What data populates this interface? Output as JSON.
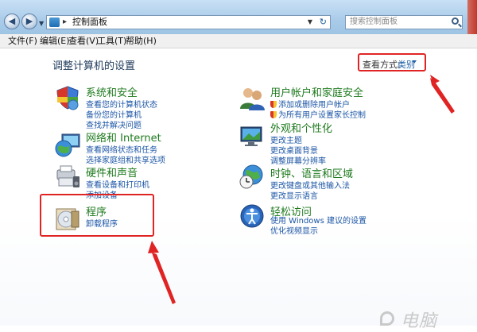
{
  "address_bar": {
    "path": "控制面板",
    "search_placeholder": "搜索控制面板"
  },
  "menu": [
    "文件(F)",
    "编辑(E)",
    "查看(V)",
    "工具(T)",
    "帮助(H)"
  ],
  "page_title": "调整计算机的设置",
  "view_by": {
    "label": "查看方式:",
    "value": "类别"
  },
  "categories": [
    {
      "title": "系统和安全",
      "links": [
        "查看您的计算机状态",
        "备份您的计算机",
        "查找并解决问题"
      ]
    },
    {
      "title": "网络和 Internet",
      "links": [
        "查看网络状态和任务",
        "选择家庭组和共享选项"
      ]
    },
    {
      "title": "硬件和声音",
      "links": [
        "查看设备和打印机",
        "添加设备"
      ]
    },
    {
      "title": "程序",
      "links": [
        "卸载程序"
      ]
    },
    {
      "title": "用户帐户和家庭安全",
      "links": [
        "添加或删除用户帐户",
        "为所有用户设置家长控制"
      ]
    },
    {
      "title": "外观和个性化",
      "links": [
        "更改主题",
        "更改桌面背景",
        "调整屏幕分辨率"
      ]
    },
    {
      "title": "时钟、语言和区域",
      "links": [
        "更改键盘或其他输入法",
        "更改显示语言"
      ]
    },
    {
      "title": "轻松访问",
      "links": [
        "使用 Windows 建议的设置",
        "优化视频显示"
      ]
    }
  ],
  "colors": {
    "highlight": "#e02424",
    "category_title": "#1e7a1e",
    "link": "#1c56a6"
  },
  "watermark": "电脑"
}
